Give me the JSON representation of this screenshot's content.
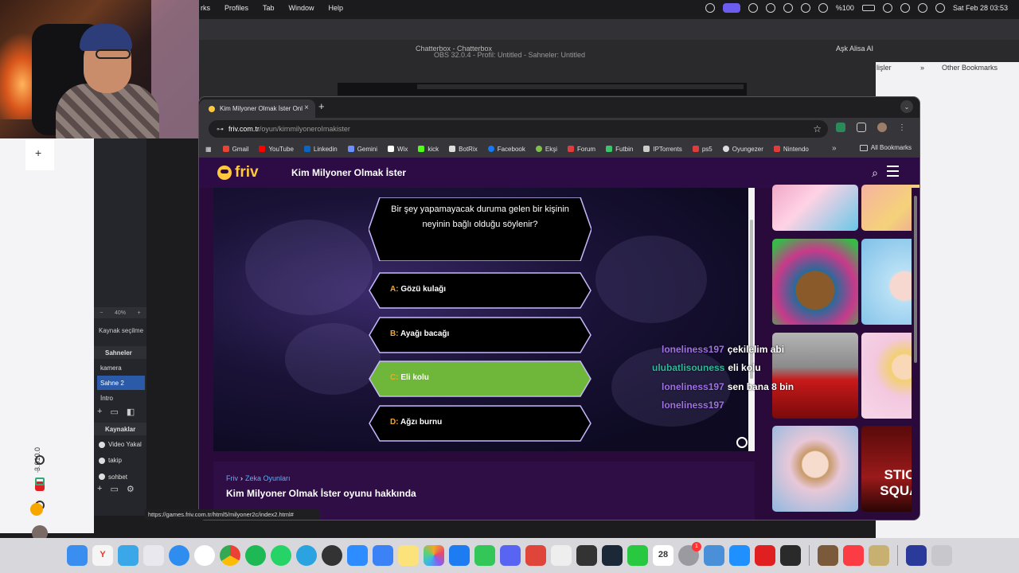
{
  "menubar": {
    "menus": [
      "rks",
      "Profiles",
      "Tab",
      "Window",
      "Help"
    ],
    "battery": "%100",
    "datetime": "Sat Feb 28  03:53"
  },
  "obs": {
    "window_title": "OBS 32.0.4 - Profil: Untitled - Sahneler: Untitled",
    "zoom": "40%",
    "source_select_label": "Kaynak seçilme",
    "scenes_header": "Sahneler",
    "scenes": [
      "kamera",
      "Sahne 2",
      "İntro"
    ],
    "sources_header": "Kaynaklar",
    "sources": [
      "Video Yakal",
      "takip",
      "sohbet"
    ],
    "version": "3.610.0"
  },
  "background_chrome": {
    "tab_partial": "Chatterbox - Chatterbox",
    "profile_partial": "Aşk Alisa AI",
    "other_bookmarks": "Other Bookmarks",
    "left_partial": "lişler"
  },
  "chrome": {
    "tab_title": "Kim Milyoner Olmak İster Onl",
    "url_host": "friv.com.tr",
    "url_path": "/oyun/kimmilyoneroImakister",
    "bookmarks": [
      {
        "label": "Gmail",
        "color": "#ea4335"
      },
      {
        "label": "YouTube",
        "color": "#ff0000"
      },
      {
        "label": "Linkedin",
        "color": "#0a66c2"
      },
      {
        "label": "Gemini",
        "color": "#6d8fff"
      },
      {
        "label": "Wix",
        "color": "#ffffff"
      },
      {
        "label": "kick",
        "color": "#53fc18"
      },
      {
        "label": "BotRix",
        "color": "#dddddd"
      },
      {
        "label": "Facebook",
        "color": "#1877f2"
      },
      {
        "label": "Ekşi",
        "color": "#81c14b"
      },
      {
        "label": "Forum",
        "color": "#e23b3b"
      },
      {
        "label": "Futbin",
        "color": "#3cc66a"
      },
      {
        "label": "IPTorrents",
        "color": "#cccccc"
      },
      {
        "label": "ps5",
        "color": "#e23b3b"
      },
      {
        "label": "Oyungezer",
        "color": "#dddddd"
      },
      {
        "label": "Nintendo",
        "color": "#e23b3b"
      }
    ],
    "all_bookmarks": "All Bookmarks",
    "status_url": "https://games.friv.com.tr/html5/milyoner2c/index2.html#"
  },
  "site": {
    "logo": "friv",
    "title": "Kim Milyoner Olmak İster",
    "breadcrumb": [
      "Friv",
      "Zeka Oyunları"
    ],
    "about_title": "Kim Milyoner Olmak İster oyunu hakkında"
  },
  "game": {
    "question": "Bir şey yapamayacak duruma gelen bir kişinin neyinin bağlı olduğu söylenir?",
    "answers": [
      {
        "letter": "A:",
        "text": "Gözü kulağı",
        "selected": false
      },
      {
        "letter": "B:",
        "text": "Ayağı bacağı",
        "selected": false
      },
      {
        "letter": "C:",
        "text": "Eli kolu",
        "selected": true
      },
      {
        "letter": "D:",
        "text": "Ağzı burnu",
        "selected": false
      }
    ],
    "selected_color": "#6fb73a",
    "frame_color": "#c9b8ff"
  },
  "chat": [
    {
      "user": "loneliness197",
      "msg": "çekilelim abi",
      "color": "#a070e8"
    },
    {
      "user": "ulubatlisouness",
      "msg": "eli kolu",
      "color": "#2fb89a"
    },
    {
      "user": "loneliness197",
      "msg": "sen bana 8 bin",
      "color": "#a070e8"
    },
    {
      "user": "loneliness197",
      "msg": "",
      "color": "#a070e8"
    }
  ],
  "thumbnails": [
    {
      "icon": "makeup-game-thumb"
    },
    {
      "icon": "princess-game-thumb"
    },
    {
      "icon": "pou-hair-game-thumb"
    },
    {
      "icon": "baby-bath-game-thumb"
    },
    {
      "icon": "car-game-thumb"
    },
    {
      "icon": "doll-game-thumb"
    },
    {
      "icon": "baby-hazel-game-thumb"
    },
    {
      "icon": "stick-squad-game-thumb",
      "label": "STICK SQUAD"
    }
  ],
  "dock": {
    "calendar_day": "28",
    "badge": "1"
  }
}
